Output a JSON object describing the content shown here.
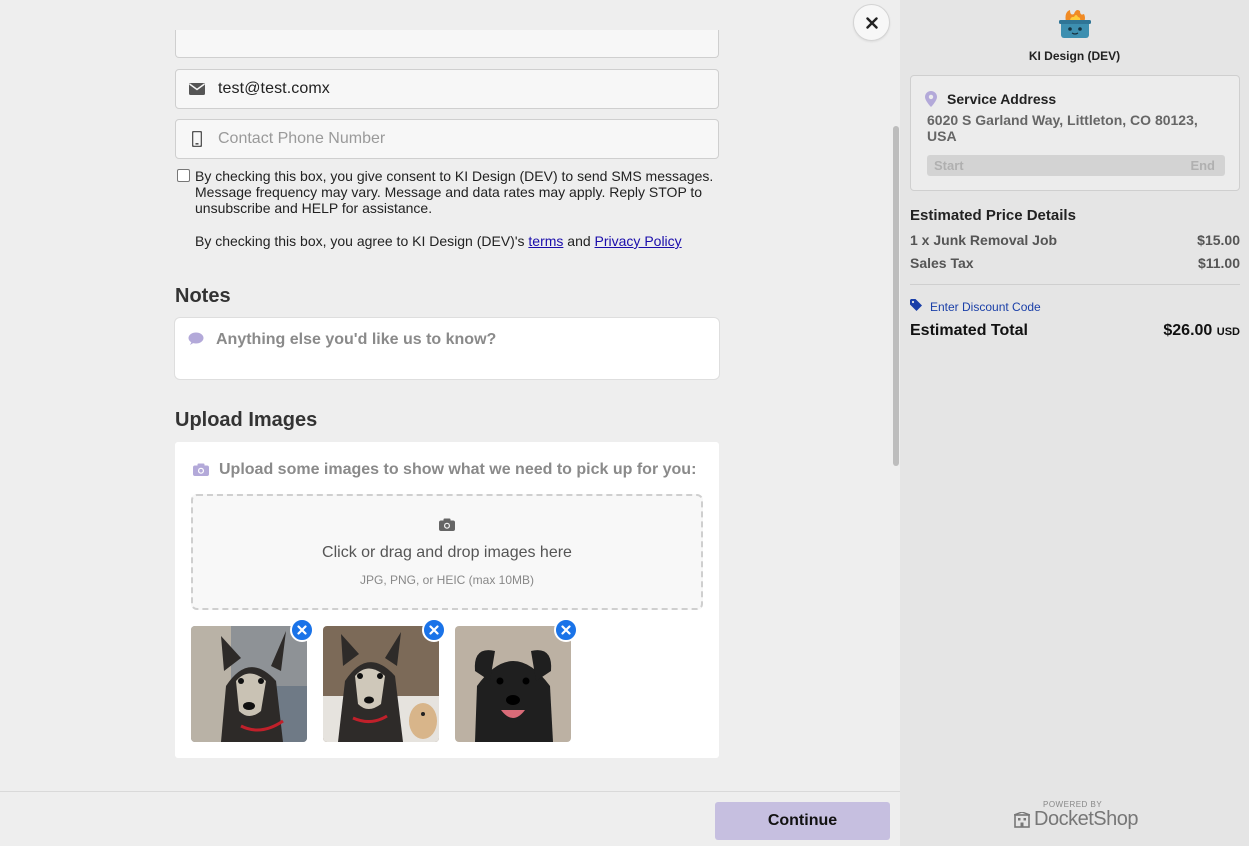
{
  "form": {
    "email_value": "test@test.comx",
    "phone_placeholder": "Contact Phone Number",
    "sms_consent_text": "By checking this box, you give consent to KI Design (DEV) to send SMS messages. Message frequency may vary. Message and data rates may apply. Reply STOP to unsubscribe and HELP for assistance.",
    "agree_prefix": "By checking this box, you agree to KI Design (DEV)'s ",
    "agree_terms_link": "terms",
    "agree_and": " and ",
    "agree_privacy_link": "Privacy Policy"
  },
  "notes": {
    "heading": "Notes",
    "placeholder": "Anything else you'd like us to know?"
  },
  "upload": {
    "heading": "Upload Images",
    "prompt": "Upload some images to show what we need to pick up for you:",
    "dropzone_title": "Click or drag and drop images here",
    "dropzone_hint": "JPG, PNG, or HEIC (max 10MB)",
    "thumbnails": [
      "dog-photo-1",
      "dog-photo-2",
      "dog-photo-3"
    ]
  },
  "footer": {
    "continue_label": "Continue"
  },
  "sidebar": {
    "brand_name": "KI Design (DEV)",
    "service_address_title": "Service Address",
    "service_address": "6020 S Garland Way, Littleton, CO 80123, USA",
    "time_start": "Start",
    "time_end": "End",
    "price_title": "Estimated Price Details",
    "line_items": [
      {
        "label": "1 x Junk Removal Job",
        "amount": "$15.00"
      },
      {
        "label": "Sales Tax",
        "amount": "$11.00"
      }
    ],
    "discount_label": "Enter Discount Code",
    "total_label": "Estimated Total",
    "total_amount": "$26.00",
    "total_currency": "USD",
    "powered_by": "POWERED BY",
    "platform_name": "DocketShop"
  },
  "colors": {
    "accent_button": "#c6bfe0",
    "link_blue": "#1a0dab",
    "remove_badge": "#1a73e8",
    "icon_lilac": "#b3a9d9"
  }
}
